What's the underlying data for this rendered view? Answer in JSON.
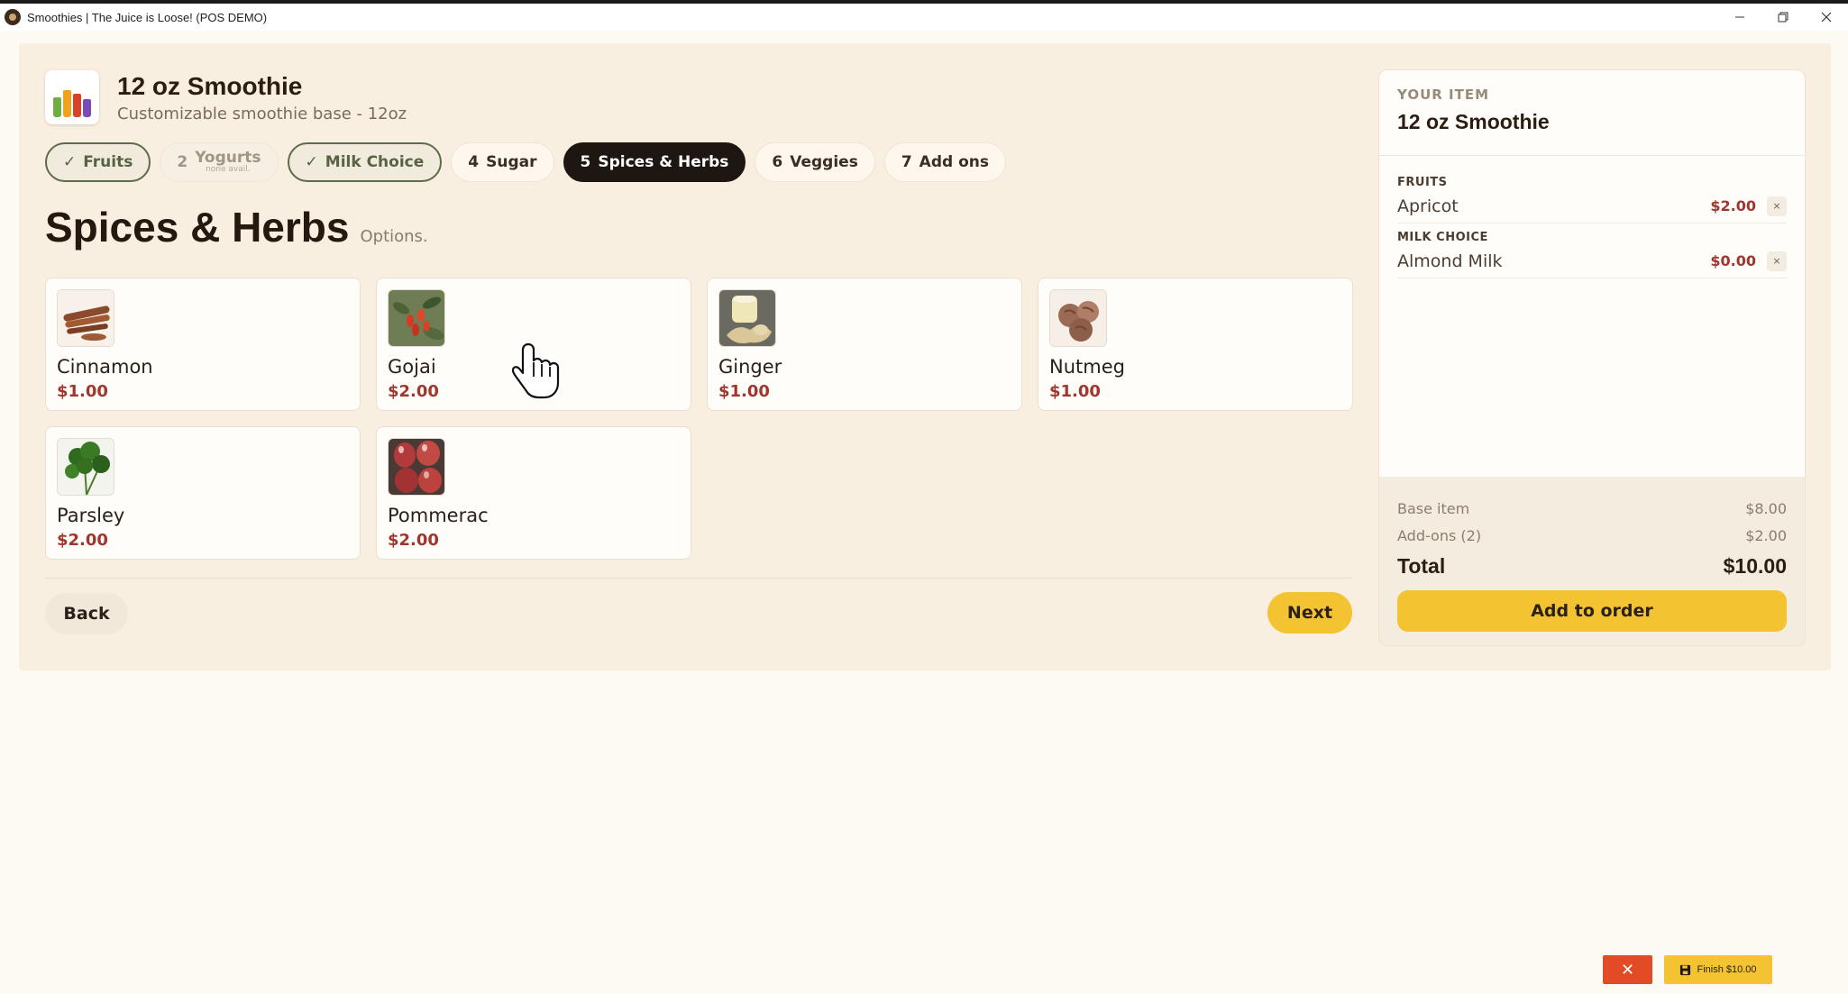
{
  "window": {
    "title": "Smoothies | The Juice is Loose! (POS DEMO)",
    "controls": [
      "minimize-icon",
      "restore-icon",
      "close-icon"
    ]
  },
  "product": {
    "title": "12 oz Smoothie",
    "subtitle": "Customizable smoothie base - 12oz",
    "thumb_icon": "smoothie-cups-icon"
  },
  "steps": [
    {
      "num": "✓",
      "label": "Fruits",
      "state": "done"
    },
    {
      "num": "2",
      "label": "Yogurts",
      "note": "none avail.",
      "state": "disabled"
    },
    {
      "num": "✓",
      "label": "Milk Choice",
      "state": "done"
    },
    {
      "num": "4",
      "label": "Sugar",
      "state": "default"
    },
    {
      "num": "5",
      "label": "Spices & Herbs",
      "state": "active"
    },
    {
      "num": "6",
      "label": "Veggies",
      "state": "default"
    },
    {
      "num": "7",
      "label": "Add ons",
      "state": "default"
    }
  ],
  "section": {
    "title": "Spices & Herbs",
    "hint": "Options."
  },
  "options": [
    {
      "name": "Cinnamon",
      "price": "$1.00",
      "image": "cinnamon-image"
    },
    {
      "name": "Gojai",
      "price": "$2.00",
      "image": "goji-image"
    },
    {
      "name": "Ginger",
      "price": "$1.00",
      "image": "ginger-image"
    },
    {
      "name": "Nutmeg",
      "price": "$1.00",
      "image": "nutmeg-image"
    },
    {
      "name": "Parsley",
      "price": "$2.00",
      "image": "parsley-image"
    },
    {
      "name": "Pommerac",
      "price": "$2.00",
      "image": "pommerac-image"
    }
  ],
  "nav": {
    "back_label": "Back",
    "next_label": "Next"
  },
  "summary": {
    "label": "YOUR ITEM",
    "item": "12 oz Smoothie",
    "groups": [
      {
        "label": "FRUITS",
        "lines": [
          {
            "name": "Apricot",
            "price": "$2.00",
            "remove": "×"
          }
        ]
      },
      {
        "label": "MILK CHOICE",
        "lines": [
          {
            "name": "Almond Milk",
            "price": "$0.00",
            "remove": "×"
          }
        ]
      }
    ],
    "base_label": "Base item",
    "base_value": "$8.00",
    "addons_label": "Add-ons (2)",
    "addons_value": "$2.00",
    "total_label": "Total",
    "total_value": "$10.00",
    "add_label": "Add to order"
  },
  "footer": {
    "cancel_label": "✕",
    "finish_label": "Finish $10.00"
  },
  "colors": {
    "accent": "#f4c332",
    "dark": "#1e1611",
    "price": "#a0372e",
    "done": "#5f6a49",
    "panel": "#f9efe1",
    "cancel": "#e24b26"
  }
}
